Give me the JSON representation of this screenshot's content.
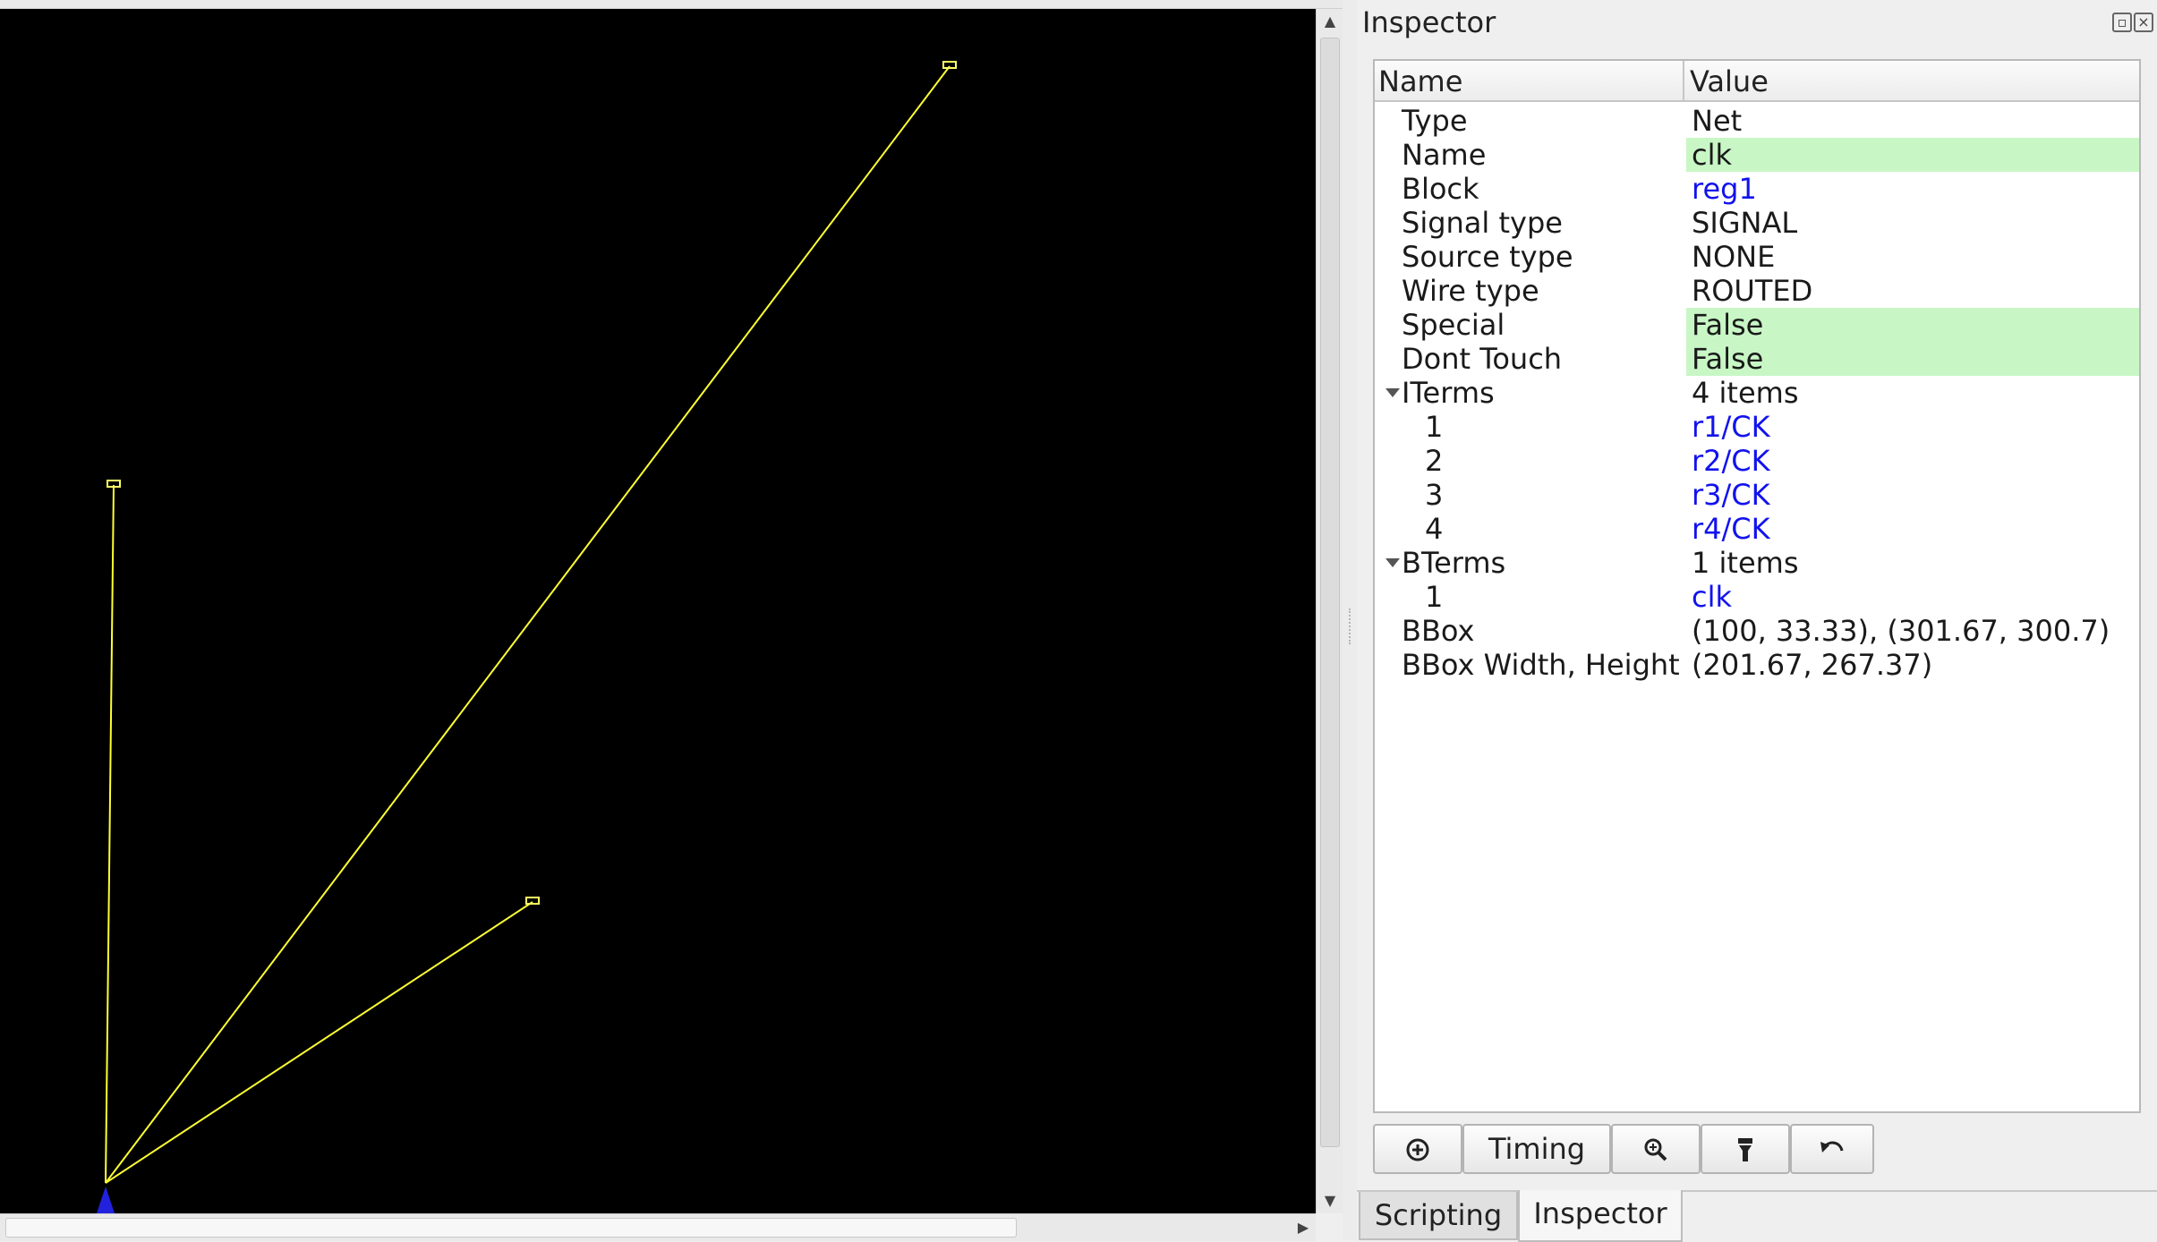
{
  "inspector": {
    "title": "Inspector",
    "columns": {
      "name": "Name",
      "value": "Value"
    },
    "rows": [
      {
        "name": "Type",
        "value": "Net",
        "indent": 1,
        "style": ""
      },
      {
        "name": "Name",
        "value": "clk",
        "indent": 1,
        "style": "hl"
      },
      {
        "name": "Block",
        "value": "reg1",
        "indent": 1,
        "style": "link"
      },
      {
        "name": "Signal type",
        "value": "SIGNAL",
        "indent": 1,
        "style": ""
      },
      {
        "name": "Source type",
        "value": "NONE",
        "indent": 1,
        "style": ""
      },
      {
        "name": "Wire type",
        "value": "ROUTED",
        "indent": 1,
        "style": ""
      },
      {
        "name": "Special",
        "value": "False",
        "indent": 1,
        "style": "hl"
      },
      {
        "name": "Dont Touch",
        "value": "False",
        "indent": 1,
        "style": "hl"
      },
      {
        "name": "ITerms",
        "value": "4 items",
        "indent": 1,
        "style": "",
        "expanded": true
      },
      {
        "name": "1",
        "value": "r1/CK",
        "indent": 2,
        "style": "link"
      },
      {
        "name": "2",
        "value": "r2/CK",
        "indent": 2,
        "style": "link"
      },
      {
        "name": "3",
        "value": "r3/CK",
        "indent": 2,
        "style": "link"
      },
      {
        "name": "4",
        "value": "r4/CK",
        "indent": 2,
        "style": "link"
      },
      {
        "name": "BTerms",
        "value": "1 items",
        "indent": 1,
        "style": "",
        "expanded": true
      },
      {
        "name": "1",
        "value": "clk",
        "indent": 2,
        "style": "link"
      },
      {
        "name": "BBox",
        "value": "(100, 33.33), (301.67, 300.7)",
        "indent": 1,
        "style": ""
      },
      {
        "name": "BBox Width, Height",
        "value": "(201.67, 267.37)",
        "indent": 1,
        "style": ""
      }
    ],
    "toolbar": {
      "focus_icon": "add-focus-icon",
      "timing_label": "Timing",
      "zoom_icon": "zoom-in-icon",
      "highlight_icon": "flashlight-icon",
      "back_icon": "undo-icon"
    }
  },
  "tabs": [
    {
      "label": "Scripting",
      "active": false
    },
    {
      "label": "Inspector",
      "active": true
    }
  ],
  "colors": {
    "canvas_bg": "#000000",
    "net_wire": "#ffff33",
    "pin_marker": "#2222dd",
    "highlight_row": "#c8f7c5",
    "link_text": "#1212ee"
  }
}
